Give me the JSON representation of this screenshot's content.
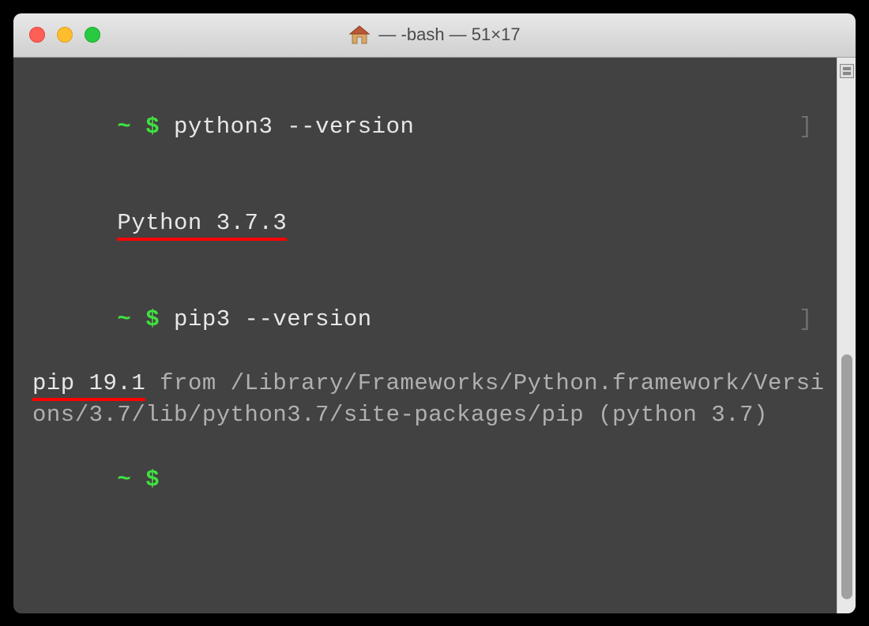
{
  "titlebar": {
    "home_icon": "home-icon",
    "title": "— -bash — 51×17"
  },
  "terminal": {
    "lines": [
      {
        "prompt_tilde": "~",
        "prompt_dollar": "$",
        "command": "python3 --version",
        "bracket": "]"
      },
      {
        "output_highlighted": "Python 3.7.3"
      },
      {
        "prompt_tilde": "~",
        "prompt_dollar": "$",
        "command": "pip3 --version",
        "bracket": "]"
      },
      {
        "output_highlighted": "pip 19.1",
        "output_rest": " from /Library/Frameworks/Python.framework/Versions/3.7/lib/python3.7/site-packages/pip (python 3.7)"
      },
      {
        "prompt_tilde": "~",
        "prompt_dollar": "$"
      }
    ]
  },
  "colors": {
    "prompt_green": "#40e040",
    "underline_red": "#ff0000",
    "terminal_bg": "#424242",
    "text_light": "#e8e8e8",
    "text_dim": "#b0b0b0"
  }
}
